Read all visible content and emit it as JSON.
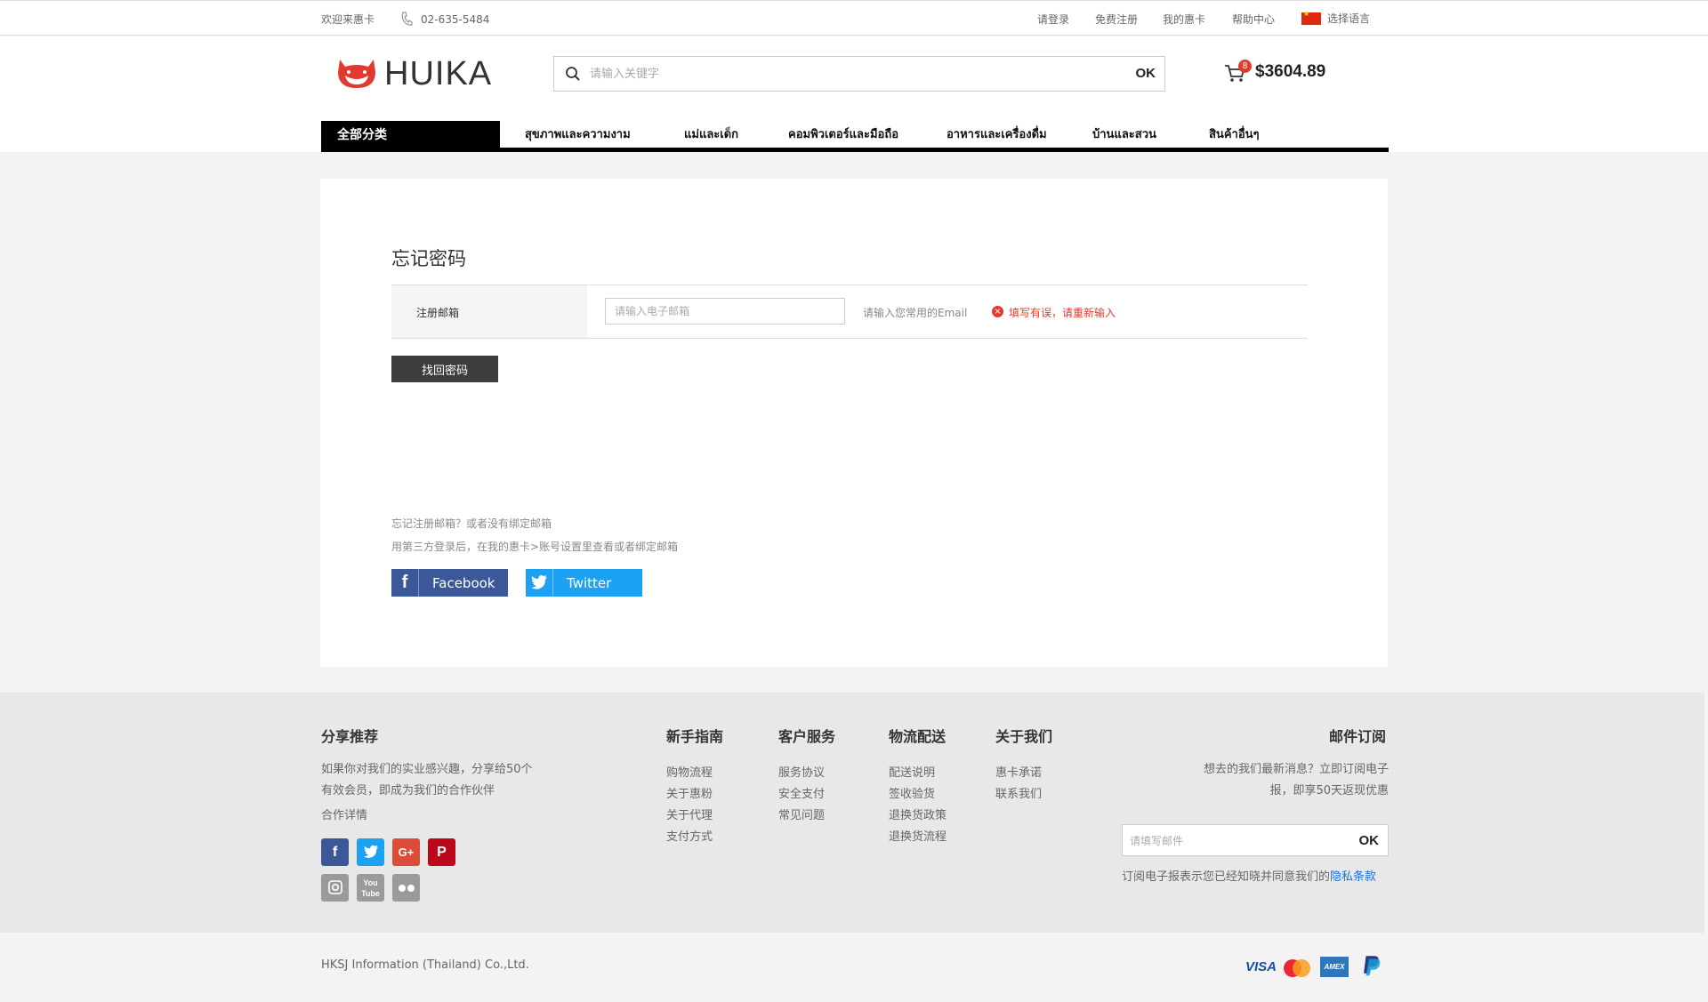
{
  "topbar": {
    "welcome": "欢迎来惠卡",
    "phone": "02-635-5484",
    "login": "请登录",
    "register": "免费注册",
    "my_account": "我的惠卡",
    "help": "帮助中心",
    "language": "选择语言"
  },
  "header": {
    "logo_text": "HUIKA",
    "search_placeholder": "请输入关键字",
    "search_button": "OK",
    "cart_count": "8",
    "cart_amount": "$3604.89"
  },
  "nav": {
    "all_categories": "全部分类",
    "items": [
      "สุขภาพและความงาม",
      "แม่และเด็ก",
      "คอมพิวเตอร์และมือถือ",
      "อาหารและเครื่องดื่ม",
      "บ้านและสวน",
      "สินค้าอื่นๆ"
    ]
  },
  "main": {
    "title": "忘记密码",
    "email_label": "注册邮箱",
    "email_placeholder": "请输入电子邮箱",
    "email_hint": "请输入您常用的Email",
    "error_text": "填写有误，请重新输入",
    "submit_button": "找回密码",
    "help_line1": "忘记注册邮箱？或者没有绑定邮箱",
    "help_line2": "用第三方登录后，在我的惠卡>账号设置里查看或者绑定邮箱",
    "facebook_label": "Facebook",
    "twitter_label": "Twitter"
  },
  "footer": {
    "share": {
      "title": "分享推荐",
      "line1": "如果你对我们的实业感兴趣，分享给50个",
      "line2": "有效会员，即成为我们的合作伙伴",
      "line3": "合作详情"
    },
    "columns": [
      {
        "title": "新手指南",
        "links": [
          "购物流程",
          "关于惠粉",
          "关于代理",
          "支付方式"
        ]
      },
      {
        "title": "客户服务",
        "links": [
          "服务协议",
          "安全支付",
          "常见问题"
        ]
      },
      {
        "title": "物流配送",
        "links": [
          "配送说明",
          "签收验货",
          "退换货政策",
          "退换货流程"
        ]
      },
      {
        "title": "关于我们",
        "links": [
          "惠卡承诺",
          "联系我们"
        ]
      }
    ],
    "subscribe": {
      "title": "邮件订阅",
      "line1": "想去的我们最新消息？立即订阅电子",
      "line2": "报，即享50天返现优惠",
      "placeholder": "请填写邮件",
      "button": "OK",
      "note": "订阅电子报表示您已经知晓并同意我们的",
      "privacy": "隐私条款"
    },
    "copyright": "HKSJ Information (Thailand) Co.,Ltd.",
    "payments": {
      "visa": "VISA",
      "amex": "AMEX"
    }
  },
  "colors": {
    "accent": "#e23a2f",
    "facebook": "#3b5998",
    "twitter": "#1da1f2",
    "link": "#1e6fd9"
  }
}
